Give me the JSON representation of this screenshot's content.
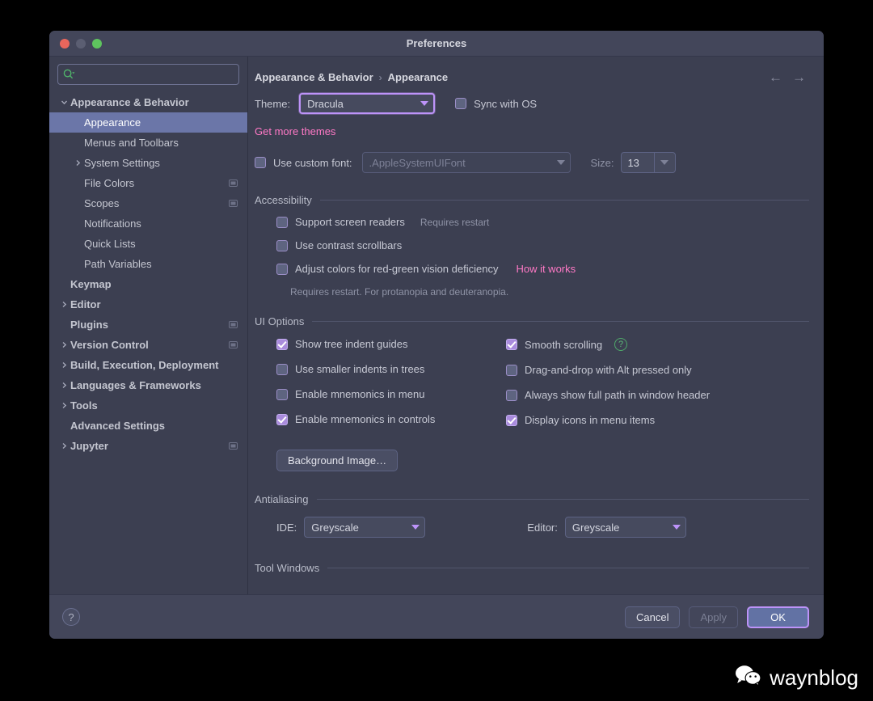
{
  "window": {
    "title": "Preferences",
    "traffic_lights": [
      "close-red",
      "minimize-grey",
      "zoom-green"
    ]
  },
  "sidebar": {
    "search": {
      "placeholder": "",
      "value": "",
      "icon": "search-icon"
    },
    "items": [
      {
        "label": "Appearance & Behavior",
        "twisty": "expanded",
        "depth": 0,
        "bold": true,
        "selected": false,
        "badge": false
      },
      {
        "label": "Appearance",
        "twisty": "none",
        "depth": 1,
        "bold": false,
        "selected": true,
        "badge": false
      },
      {
        "label": "Menus and Toolbars",
        "twisty": "none",
        "depth": 1,
        "bold": false,
        "selected": false,
        "badge": false
      },
      {
        "label": "System Settings",
        "twisty": "collapsed",
        "depth": 1,
        "bold": false,
        "selected": false,
        "badge": false
      },
      {
        "label": "File Colors",
        "twisty": "none",
        "depth": 1,
        "bold": false,
        "selected": false,
        "badge": true
      },
      {
        "label": "Scopes",
        "twisty": "none",
        "depth": 1,
        "bold": false,
        "selected": false,
        "badge": true
      },
      {
        "label": "Notifications",
        "twisty": "none",
        "depth": 1,
        "bold": false,
        "selected": false,
        "badge": false
      },
      {
        "label": "Quick Lists",
        "twisty": "none",
        "depth": 1,
        "bold": false,
        "selected": false,
        "badge": false
      },
      {
        "label": "Path Variables",
        "twisty": "none",
        "depth": 1,
        "bold": false,
        "selected": false,
        "badge": false
      },
      {
        "label": "Keymap",
        "twisty": "none",
        "depth": 0,
        "bold": true,
        "selected": false,
        "badge": false
      },
      {
        "label": "Editor",
        "twisty": "collapsed",
        "depth": 0,
        "bold": true,
        "selected": false,
        "badge": false
      },
      {
        "label": "Plugins",
        "twisty": "none",
        "depth": 0,
        "bold": true,
        "selected": false,
        "badge": true
      },
      {
        "label": "Version Control",
        "twisty": "collapsed",
        "depth": 0,
        "bold": true,
        "selected": false,
        "badge": true
      },
      {
        "label": "Build, Execution, Deployment",
        "twisty": "collapsed",
        "depth": 0,
        "bold": true,
        "selected": false,
        "badge": false
      },
      {
        "label": "Languages & Frameworks",
        "twisty": "collapsed",
        "depth": 0,
        "bold": true,
        "selected": false,
        "badge": false
      },
      {
        "label": "Tools",
        "twisty": "collapsed",
        "depth": 0,
        "bold": true,
        "selected": false,
        "badge": false
      },
      {
        "label": "Advanced Settings",
        "twisty": "none",
        "depth": 0,
        "bold": true,
        "selected": false,
        "badge": false
      },
      {
        "label": "Jupyter",
        "twisty": "collapsed",
        "depth": 0,
        "bold": true,
        "selected": false,
        "badge": true
      }
    ]
  },
  "main": {
    "breadcrumb": {
      "parent": "Appearance & Behavior",
      "separator": "›",
      "current": "Appearance"
    },
    "nav": {
      "back": "←",
      "forward": "→"
    },
    "theme": {
      "label": "Theme:",
      "value": "Dracula",
      "sync_label": "Sync with OS",
      "sync_checked": false,
      "get_more_themes": "Get more themes"
    },
    "custom_font": {
      "label": "Use custom font:",
      "checked": false,
      "font_value": ".AppleSystemUIFont",
      "size_label": "Size:",
      "size_value": "13"
    },
    "accessibility": {
      "title": "Accessibility",
      "items": [
        {
          "label": "Support screen readers",
          "checked": false,
          "note": "Requires restart",
          "link": ""
        },
        {
          "label": "Use contrast scrollbars",
          "checked": false,
          "note": "",
          "link": ""
        },
        {
          "label": "Adjust colors for red-green vision deficiency",
          "checked": false,
          "note": "",
          "link": "How it works"
        }
      ],
      "footnote": "Requires restart. For protanopia and deuteranopia."
    },
    "ui_options": {
      "title": "UI Options",
      "left_column": [
        {
          "label": "Show tree indent guides",
          "checked": true,
          "help": false
        },
        {
          "label": "Use smaller indents in trees",
          "checked": false,
          "help": false
        },
        {
          "label": "Enable mnemonics in menu",
          "checked": false,
          "help": false
        },
        {
          "label": "Enable mnemonics in controls",
          "checked": true,
          "help": false
        }
      ],
      "right_column": [
        {
          "label": "Smooth scrolling",
          "checked": true,
          "help": true
        },
        {
          "label": "Drag-and-drop with Alt pressed only",
          "checked": false,
          "help": false
        },
        {
          "label": "Always show full path in window header",
          "checked": false,
          "help": false
        },
        {
          "label": "Display icons in menu items",
          "checked": true,
          "help": false
        }
      ],
      "background_image_button": "Background Image…"
    },
    "antialiasing": {
      "title": "Antialiasing",
      "ide_label": "IDE:",
      "ide_value": "Greyscale",
      "editor_label": "Editor:",
      "editor_value": "Greyscale"
    },
    "tool_windows": {
      "title": "Tool Windows"
    }
  },
  "footer": {
    "help": "?",
    "cancel": "Cancel",
    "apply": "Apply",
    "ok": "OK"
  },
  "watermark": {
    "text": "waynblog",
    "icon": "wechat-icon"
  },
  "colors": {
    "accent_purple": "#bd93f9",
    "link_pink": "#ff79c6",
    "selection_blue": "#6b76a8",
    "window_bg": "#3c3f51",
    "titlebar_bg": "#43465a",
    "checkbox_checked": "#a98bdc",
    "green_icon": "#5cb878"
  }
}
